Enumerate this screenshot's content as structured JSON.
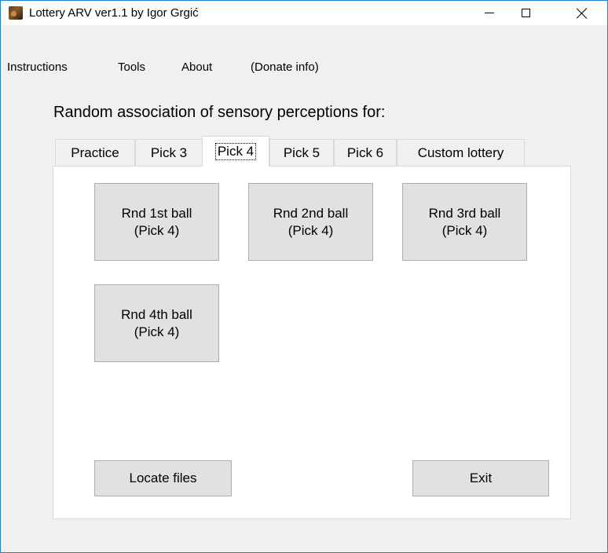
{
  "window": {
    "title": "Lottery ARV ver1.1 by Igor Grgić"
  },
  "menu": [
    "Instructions",
    "Tools",
    "About",
    "(Donate info)"
  ],
  "heading": "Random association of sensory perceptions for:",
  "tabs": [
    {
      "label": "Practice",
      "active": false
    },
    {
      "label": "Pick 3",
      "active": false
    },
    {
      "label": "Pick 4",
      "active": true
    },
    {
      "label": "Pick 5",
      "active": false
    },
    {
      "label": "Pick 6",
      "active": false
    },
    {
      "label": "Custom lottery",
      "active": false
    }
  ],
  "ball_buttons": [
    {
      "line1": "Rnd 1st ball",
      "line2": "(Pick 4)"
    },
    {
      "line1": "Rnd 2nd ball",
      "line2": "(Pick 4)"
    },
    {
      "line1": "Rnd 3rd ball",
      "line2": "(Pick 4)"
    },
    {
      "line1": "Rnd 4th ball",
      "line2": "(Pick 4)"
    }
  ],
  "footer": {
    "locate_label": "Locate files",
    "exit_label": "Exit"
  }
}
